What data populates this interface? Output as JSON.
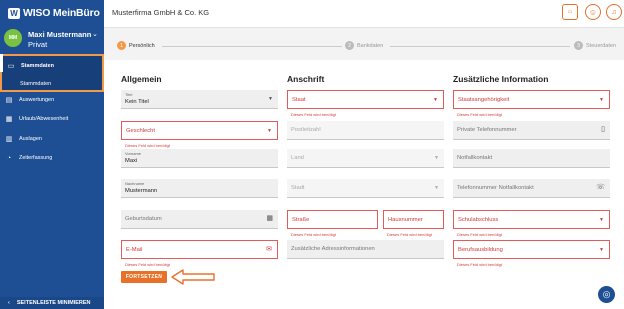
{
  "sidebar": {
    "brand": "WISO MeinBüro",
    "user": {
      "initials": "MM",
      "name": "Maxi Mustermann",
      "subtitle": "Privat"
    },
    "items": [
      {
        "label": "Stammdaten",
        "icon": "id-card-icon"
      },
      {
        "label": "Auswertungen",
        "icon": "document-icon"
      },
      {
        "label": "Urlaub/Abwesenheit",
        "icon": "calendar-icon"
      },
      {
        "label": "Auslagen",
        "icon": "receipt-icon"
      },
      {
        "label": "Zeiterfassung",
        "icon": "users-clock-icon"
      }
    ],
    "active_sub": "Stammdaten",
    "collapse_label": "SEITENLEISTE MINIMIEREN"
  },
  "topbar": {
    "company": "Musterfirma GmbH & Co. KG",
    "buttons": [
      "wiso-icon",
      "user-icon",
      "bell-icon"
    ]
  },
  "steps": [
    {
      "num": "1",
      "label": "Persönlich",
      "active": true
    },
    {
      "num": "2",
      "label": "Bankdaten",
      "active": false
    },
    {
      "num": "3",
      "label": "Steuerdaten",
      "active": false
    }
  ],
  "sections": {
    "general": "Allgemein",
    "address": "Anschrift",
    "extra": "Zusätzliche Information"
  },
  "fields": {
    "title": {
      "label": "Titel",
      "value": "Kein Titel"
    },
    "gender": {
      "placeholder": "Geschlecht"
    },
    "firstname": {
      "label": "Vorname",
      "value": "Maxi"
    },
    "lastname": {
      "label": "Nachname",
      "value": "Mustermann"
    },
    "birthdate": {
      "placeholder": "Geburtsdatum"
    },
    "email": {
      "placeholder": "E-Mail"
    },
    "state": {
      "placeholder": "Staat"
    },
    "zip": {
      "placeholder": "Postleitzahl"
    },
    "country": {
      "placeholder": "Land"
    },
    "city": {
      "placeholder": "Stadt"
    },
    "street": {
      "placeholder": "Straße"
    },
    "house": {
      "placeholder": "Hausnummer"
    },
    "address_extra": {
      "placeholder": "Zusätzliche Adressinformationen"
    },
    "nationality": {
      "placeholder": "Staatsangehörigkeit"
    },
    "phone": {
      "placeholder": "Private Telefonnummer"
    },
    "emergency": {
      "placeholder": "Notfallkontakt"
    },
    "emergency_phone": {
      "placeholder": "Telefonnummer Notfallkontakt"
    },
    "school": {
      "placeholder": "Schulabschluss"
    },
    "training": {
      "placeholder": "Berufsausbildung"
    }
  },
  "error_text": "Dieses Feld wird benötigt",
  "continue_label": "FORTSETZEN",
  "colors": {
    "accent": "#e8712a",
    "error": "#d43a3a",
    "sidebar": "#1e4f94"
  }
}
